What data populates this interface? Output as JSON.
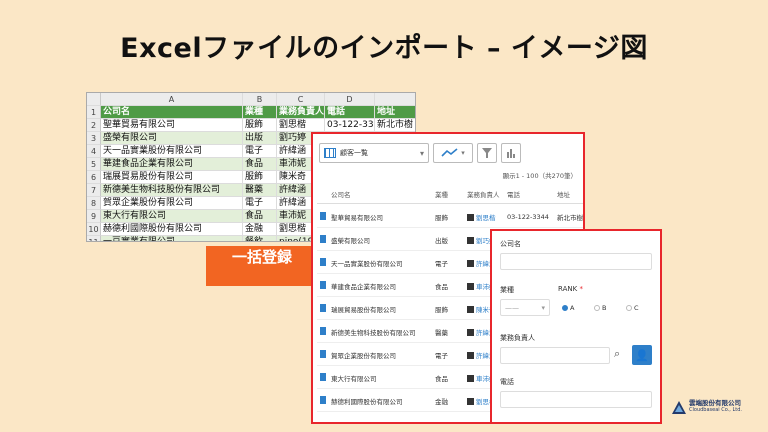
{
  "title": "Excelファイルのインポート – イメージ図",
  "excel": {
    "col_headers": [
      "",
      "A",
      "B",
      "C",
      "D",
      ""
    ],
    "header_row": [
      "公司名",
      "業種",
      "業務負責人",
      "電話",
      "地址"
    ],
    "rows": [
      [
        "聖華貿易有限公司",
        "服飾",
        "劉思楷",
        "03-122-3344",
        "新北市樹"
      ],
      [
        "盛榮有限公司",
        "出版",
        "劉巧婷",
        "",
        ""
      ],
      [
        "天一品實業股份有限公司",
        "電子",
        "許緯涵",
        "",
        ""
      ],
      [
        "華建食品企業有限公司",
        "食品",
        "車沛妮",
        "",
        ""
      ],
      [
        "瑞展貿易股份有限公司",
        "服飾",
        "陳米奇",
        "",
        ""
      ],
      [
        "新德美生物科技股份有限公司",
        "醫藥",
        "許緯涵",
        "",
        ""
      ],
      [
        "賀眾企業股份有限公司",
        "電子",
        "許緯涵",
        "",
        ""
      ],
      [
        "東大行有限公司",
        "食品",
        "車沛妮",
        "",
        ""
      ],
      [
        "赫德利國際股份有限公司",
        "金融",
        "劉思楷",
        "",
        ""
      ],
      [
        "一豆實業有限公司",
        "餐飲",
        "pino(1912)",
        "",
        ""
      ]
    ],
    "row_numbers": [
      "1",
      "2",
      "3",
      "4",
      "5",
      "6",
      "7",
      "8",
      "9",
      "10",
      "11"
    ]
  },
  "arrow_label": "一括登録",
  "app": {
    "view_label": "顧客一覧",
    "count_text": "顯示1 - 100（共270筆）",
    "columns": [
      "公司名",
      "業種",
      "業務負責人",
      "電話",
      "地址"
    ],
    "rows": [
      [
        "聖華貿易有限公司",
        "服飾",
        "劉思楷",
        "03-122-3344",
        "新北市樹"
      ],
      [
        "盛榮有限公司",
        "出版",
        "劉巧婷",
        "",
        ""
      ],
      [
        "天一品實業股份有限公司",
        "電子",
        "許緯涵",
        "",
        ""
      ],
      [
        "華建食品企業有限公司",
        "食品",
        "車沛妮",
        "",
        ""
      ],
      [
        "瑞展貿易股份有限公司",
        "服飾",
        "陳米奇",
        "",
        ""
      ],
      [
        "新德美生物科技股份有限公司",
        "醫藥",
        "許緯涵",
        "",
        ""
      ],
      [
        "賀眾企業股份有限公司",
        "電子",
        "許緯涵",
        "",
        ""
      ],
      [
        "東大行有限公司",
        "食品",
        "車沛妮",
        "",
        ""
      ],
      [
        "赫德利國際股份有限公司",
        "金融",
        "劉思楷",
        "",
        ""
      ]
    ]
  },
  "form": {
    "company_label": "公司名",
    "industry_label": "業種",
    "industry_value": "——",
    "rank_label": "RANK",
    "rank_options": [
      "A",
      "B",
      "C"
    ],
    "rank_selected": "A",
    "owner_label": "業務負責人",
    "phone_label": "電話"
  },
  "logo": {
    "name": "雲端股份有限公司",
    "sub": "Cloudbaseai Co., Ltd."
  },
  "colors": {
    "accent": "#e8262c",
    "brand": "#2e7fc9",
    "excel_green": "#4f9b46",
    "arrow": "#f26522"
  }
}
